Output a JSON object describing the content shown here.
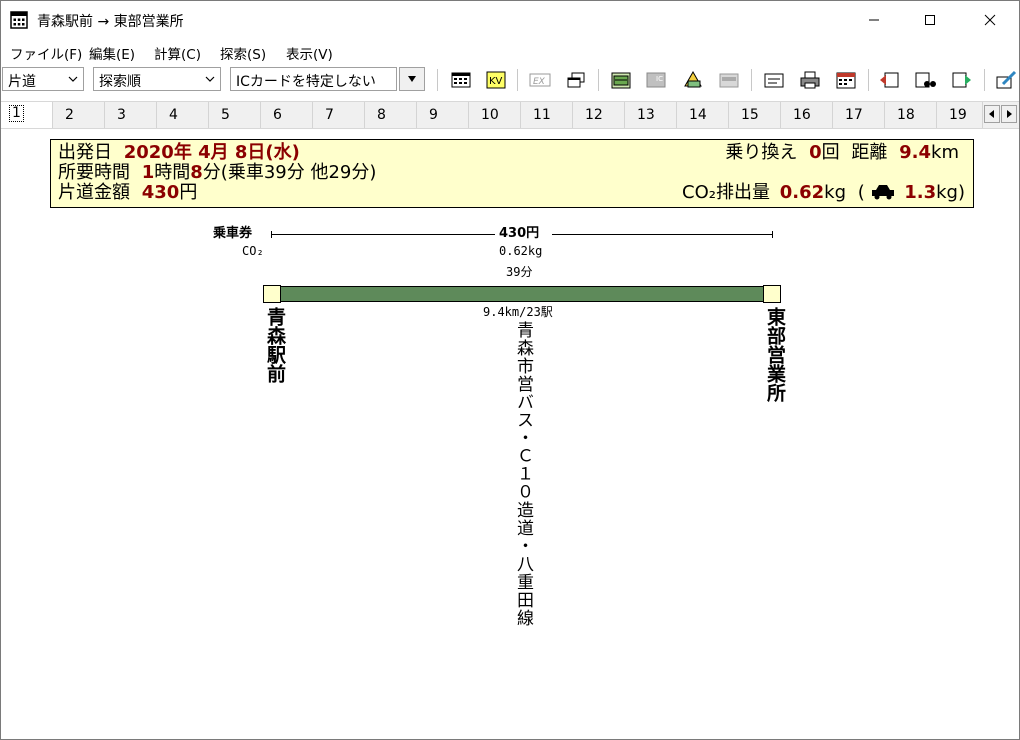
{
  "window": {
    "title": "青森駅前 → 東部営業所",
    "controls": {
      "minimize": "minimize-icon",
      "maximize": "maximize-icon",
      "close": "close-icon"
    }
  },
  "menu": [
    {
      "label": "ファイル(F)"
    },
    {
      "label": "編集(E)"
    },
    {
      "label": "計算(C)"
    },
    {
      "label": "探索(S)"
    },
    {
      "label": "表示(V)"
    }
  ],
  "toolbar": {
    "trip_type": "片道",
    "sort_order": "探索順",
    "ic_card": "ICカードを特定しない",
    "icons": [
      "timetable-icon",
      "ic-search-icon",
      "express-icon",
      "window-icon",
      "pass-icon",
      "ic-card-icon",
      "teiki-icon",
      "commuter-icon",
      "memo-icon",
      "print-icon",
      "calendar-icon",
      "back-icon",
      "binoculars-icon",
      "forward-icon",
      "edit-icon"
    ]
  },
  "tabs": [
    "1",
    "2",
    "3",
    "4",
    "5",
    "6",
    "7",
    "8",
    "9",
    "10",
    "11",
    "12",
    "13",
    "14",
    "15",
    "16",
    "17",
    "18",
    "19"
  ],
  "active_tab": "1",
  "summary": {
    "departure_label": "出発日",
    "departure_value": "2020年 4月 8日(水)",
    "duration_label": "所要時間",
    "duration_hours": "1",
    "duration_hours_unit": "時間",
    "duration_minutes": "8",
    "duration_detail": "分(乗車39分 他29分)",
    "fare_label": "片道金額",
    "fare_value": "430",
    "fare_unit": "円",
    "transfers_label": "乗り換え",
    "transfers_value": "0",
    "transfers_unit": "回",
    "distance_label": "距離",
    "distance_value": "9.4",
    "distance_unit": "km",
    "co2_label": "CO₂排出量",
    "co2_value": "0.62",
    "co2_unit": "kg",
    "car_paren_open": "(",
    "car_co2_value": "1.3",
    "car_co2_unit": "kg)",
    "colors": {
      "value": "#8b0000",
      "background": "#ffffcc"
    }
  },
  "route": {
    "ticket_label": "乗車券",
    "fare": "430円",
    "co2_label": "CO₂",
    "co2": "0.62kg",
    "ride_time": "39分",
    "distance_stops": "9.4km/23駅",
    "origin": "青森駅前",
    "destination": "東部営業所",
    "line": "青森市営バス・Ｃ１０造道・八重田線",
    "line_color": "#5e8a5a"
  }
}
